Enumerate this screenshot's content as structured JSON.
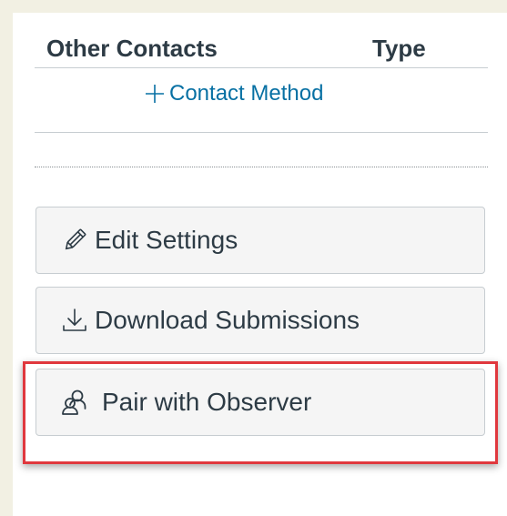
{
  "contacts_table": {
    "col_other": "Other Contacts",
    "col_type": "Type",
    "add_contact_label": "Contact Method",
    "add_icon": "plus-icon"
  },
  "actions": {
    "edit_settings": {
      "label": "Edit Settings",
      "icon": "pencil-icon"
    },
    "download_submissions": {
      "label": "Download Submissions",
      "icon": "download-icon"
    },
    "pair_with_observer": {
      "label": "Pair with Observer",
      "icon": "people-icon"
    }
  },
  "colors": {
    "link": "#0770a3",
    "text": "#2d3b45",
    "highlight": "#e0383e",
    "page_bg": "#f2f0e3"
  }
}
